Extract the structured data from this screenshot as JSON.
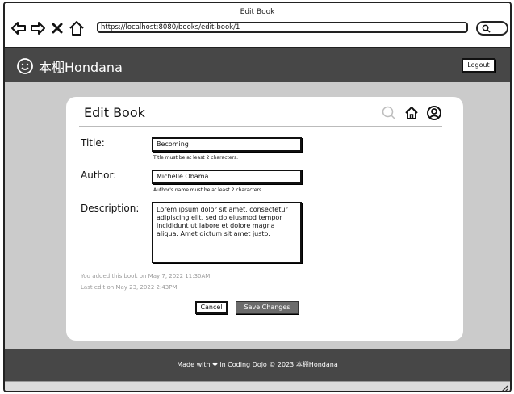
{
  "browser": {
    "window_title": "Edit Book",
    "url": "https://localhost:8080/books/edit-book/1"
  },
  "navbar": {
    "brand_text": "本棚Hondana",
    "logout_label": "Logout"
  },
  "card": {
    "title": "Edit Book",
    "icons": [
      "search-icon",
      "home-icon",
      "user-icon"
    ]
  },
  "form": {
    "title": {
      "label": "Title:",
      "value": "Becoming",
      "help": "Title must be at least 2 characters."
    },
    "author": {
      "label": "Author:",
      "value": "Michelle Obama",
      "help": "Author's name must be at least 2 characters."
    },
    "description": {
      "label": "Description:",
      "value": "Lorem ipsum dolor sit amet, consectetur adipiscing elit, sed do eiusmod tempor incididunt ut labore et dolore magna aliqua. Amet dictum sit amet justo."
    }
  },
  "meta": {
    "added": "You added this book on May 7, 2022 11:30AM.",
    "edited": "Last edit on May 23, 2022 2:43PM."
  },
  "buttons": {
    "cancel": "Cancel",
    "save": "Save Changes"
  },
  "footer": {
    "text": "Made with ❤ in Coding Dojo © 2023 本棚Hondana"
  },
  "colors": {
    "navbar": "#474747",
    "page_background": "#cbcbcb",
    "save_button": "#6b6b6b"
  }
}
